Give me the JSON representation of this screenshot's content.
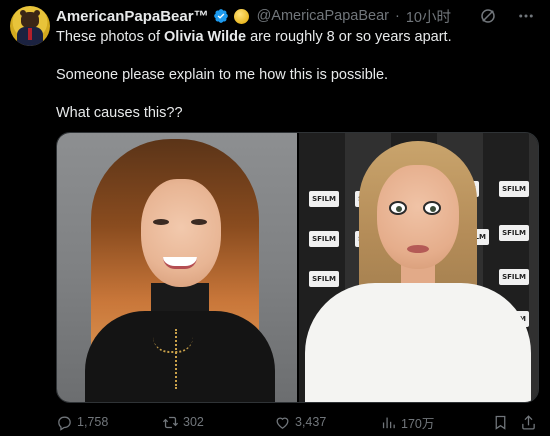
{
  "tweet": {
    "display_name": "AmericanPapaBear™",
    "handle": "@AmericaPapaBear",
    "separator": "·",
    "time": "10小时",
    "line1_prefix": "These photos of ",
    "line1_bold": "Olivia Wilde",
    "line1_suffix": " are roughly 8 or so years apart.",
    "line2": "Someone please explain to me how this is possible.",
    "line3": "What causes this??",
    "media_sign_text": "SFILM"
  },
  "stats": {
    "replies": "1,758",
    "reposts": "302",
    "likes": "3,437",
    "views": "170万"
  },
  "icons": {
    "verified": "verified-badge-icon",
    "affiliate": "gold-affiliate-badge-icon",
    "grok": "grok-icon",
    "more": "more-icon",
    "reply": "reply-icon",
    "repost": "repost-icon",
    "like": "like-icon",
    "views": "views-icon",
    "bookmark": "bookmark-icon",
    "share": "share-icon"
  },
  "colors": {
    "background": "#000000",
    "text": "#e7e9ea",
    "muted": "#71767b",
    "verified": "#1d9bf0"
  }
}
